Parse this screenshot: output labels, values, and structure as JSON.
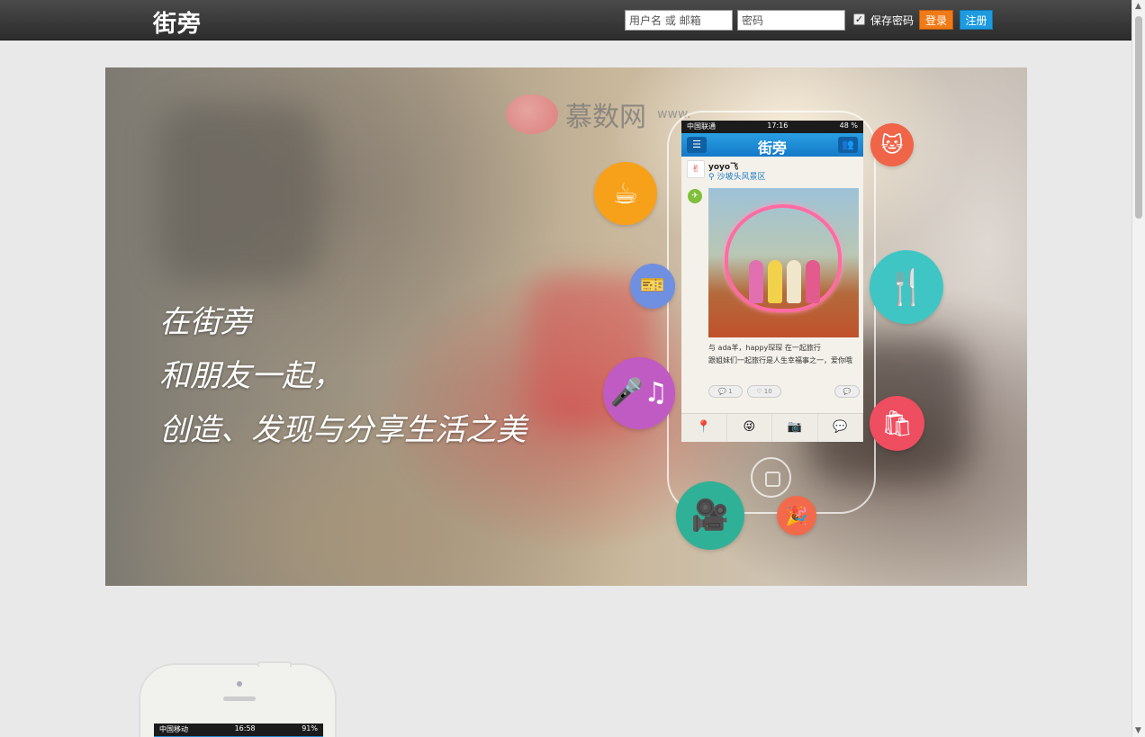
{
  "header": {
    "logo": "街旁",
    "username_placeholder": "用户名 或 邮箱",
    "password_placeholder": "密码",
    "remember_label": "保存密码",
    "remember_checked": true,
    "login_label": "登录",
    "register_label": "注册",
    "colors": {
      "login": "#f07a16",
      "register": "#1e9be0"
    }
  },
  "hero": {
    "slogan_lines": [
      "在街旁",
      "和朋友一起，",
      "创造、发现与分享生活之美"
    ],
    "watermark_text": "慕数网",
    "watermark_url": "www.",
    "phone": {
      "carrier": "中国联通",
      "time": "17:16",
      "battery": "48 %",
      "app_title": "街旁",
      "post_user": "yoyo飞",
      "post_location": "沙坡头风景区",
      "caption_line1": "与 ada羊，happy琛琛 在一起旅行",
      "caption_line2": "跟姐妹们一起旅行是人生幸福事之一，爱你哦",
      "like_count": "1",
      "heart_count": "10"
    },
    "bubbles": [
      {
        "name": "coffee-icon",
        "glyph": "☕",
        "color": "#f7a11a"
      },
      {
        "name": "ticket-icon",
        "glyph": "🎫",
        "color": "#6f8fe0"
      },
      {
        "name": "microphone-icon",
        "glyph": "🎤♫",
        "color": "#c15bc4"
      },
      {
        "name": "camera-video-icon",
        "glyph": "🎥",
        "color": "#2fb197"
      },
      {
        "name": "party-hat-icon",
        "glyph": "🎉",
        "color": "#f26a4b"
      },
      {
        "name": "cat-icon",
        "glyph": "🐱",
        "color": "#f06448"
      },
      {
        "name": "dining-icon",
        "glyph": "🍴",
        "color": "#3fc6c4"
      },
      {
        "name": "shopping-bag-icon",
        "glyph": "🛍",
        "color": "#ef4e60"
      }
    ]
  },
  "second_phone": {
    "carrier": "中国移动",
    "time": "16:58",
    "battery": "91%"
  }
}
